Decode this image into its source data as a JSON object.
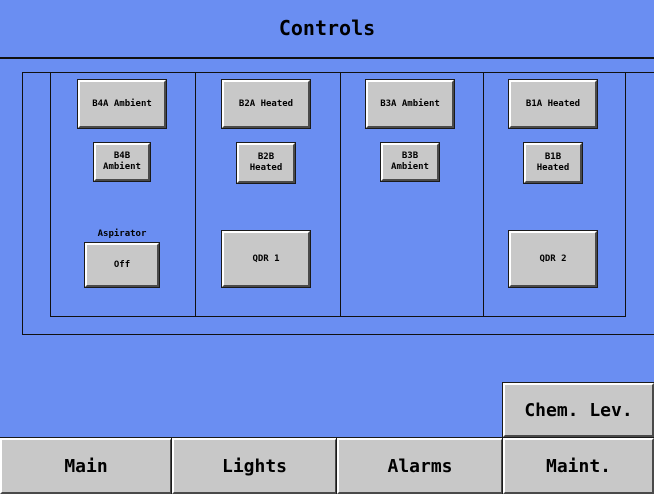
{
  "header": {
    "title": "Controls"
  },
  "zones": [
    {
      "id": "b4",
      "main_button": "B4A Ambient",
      "sub_button": "B4B\nAmbient",
      "aspirator_label": "Aspirator",
      "aspirator_button": "Off"
    },
    {
      "id": "b2",
      "main_button": "B2A Heated",
      "sub_button": "B2B\nHeated",
      "qdr_button": "QDR 1"
    },
    {
      "id": "b3",
      "main_button": "B3A Ambient",
      "sub_button": "B3B\nAmbient"
    },
    {
      "id": "b1",
      "main_button": "B1A Heated",
      "sub_button": "B1B\nHeated",
      "qdr_button": "QDR 2"
    }
  ],
  "chem_button": "Chem. Lev.",
  "nav": {
    "main": "Main",
    "lights": "Lights",
    "alarms": "Alarms",
    "maint": "Maint."
  },
  "colors": {
    "background": "#6a8ef2",
    "button_face": "#c8c8c8"
  }
}
